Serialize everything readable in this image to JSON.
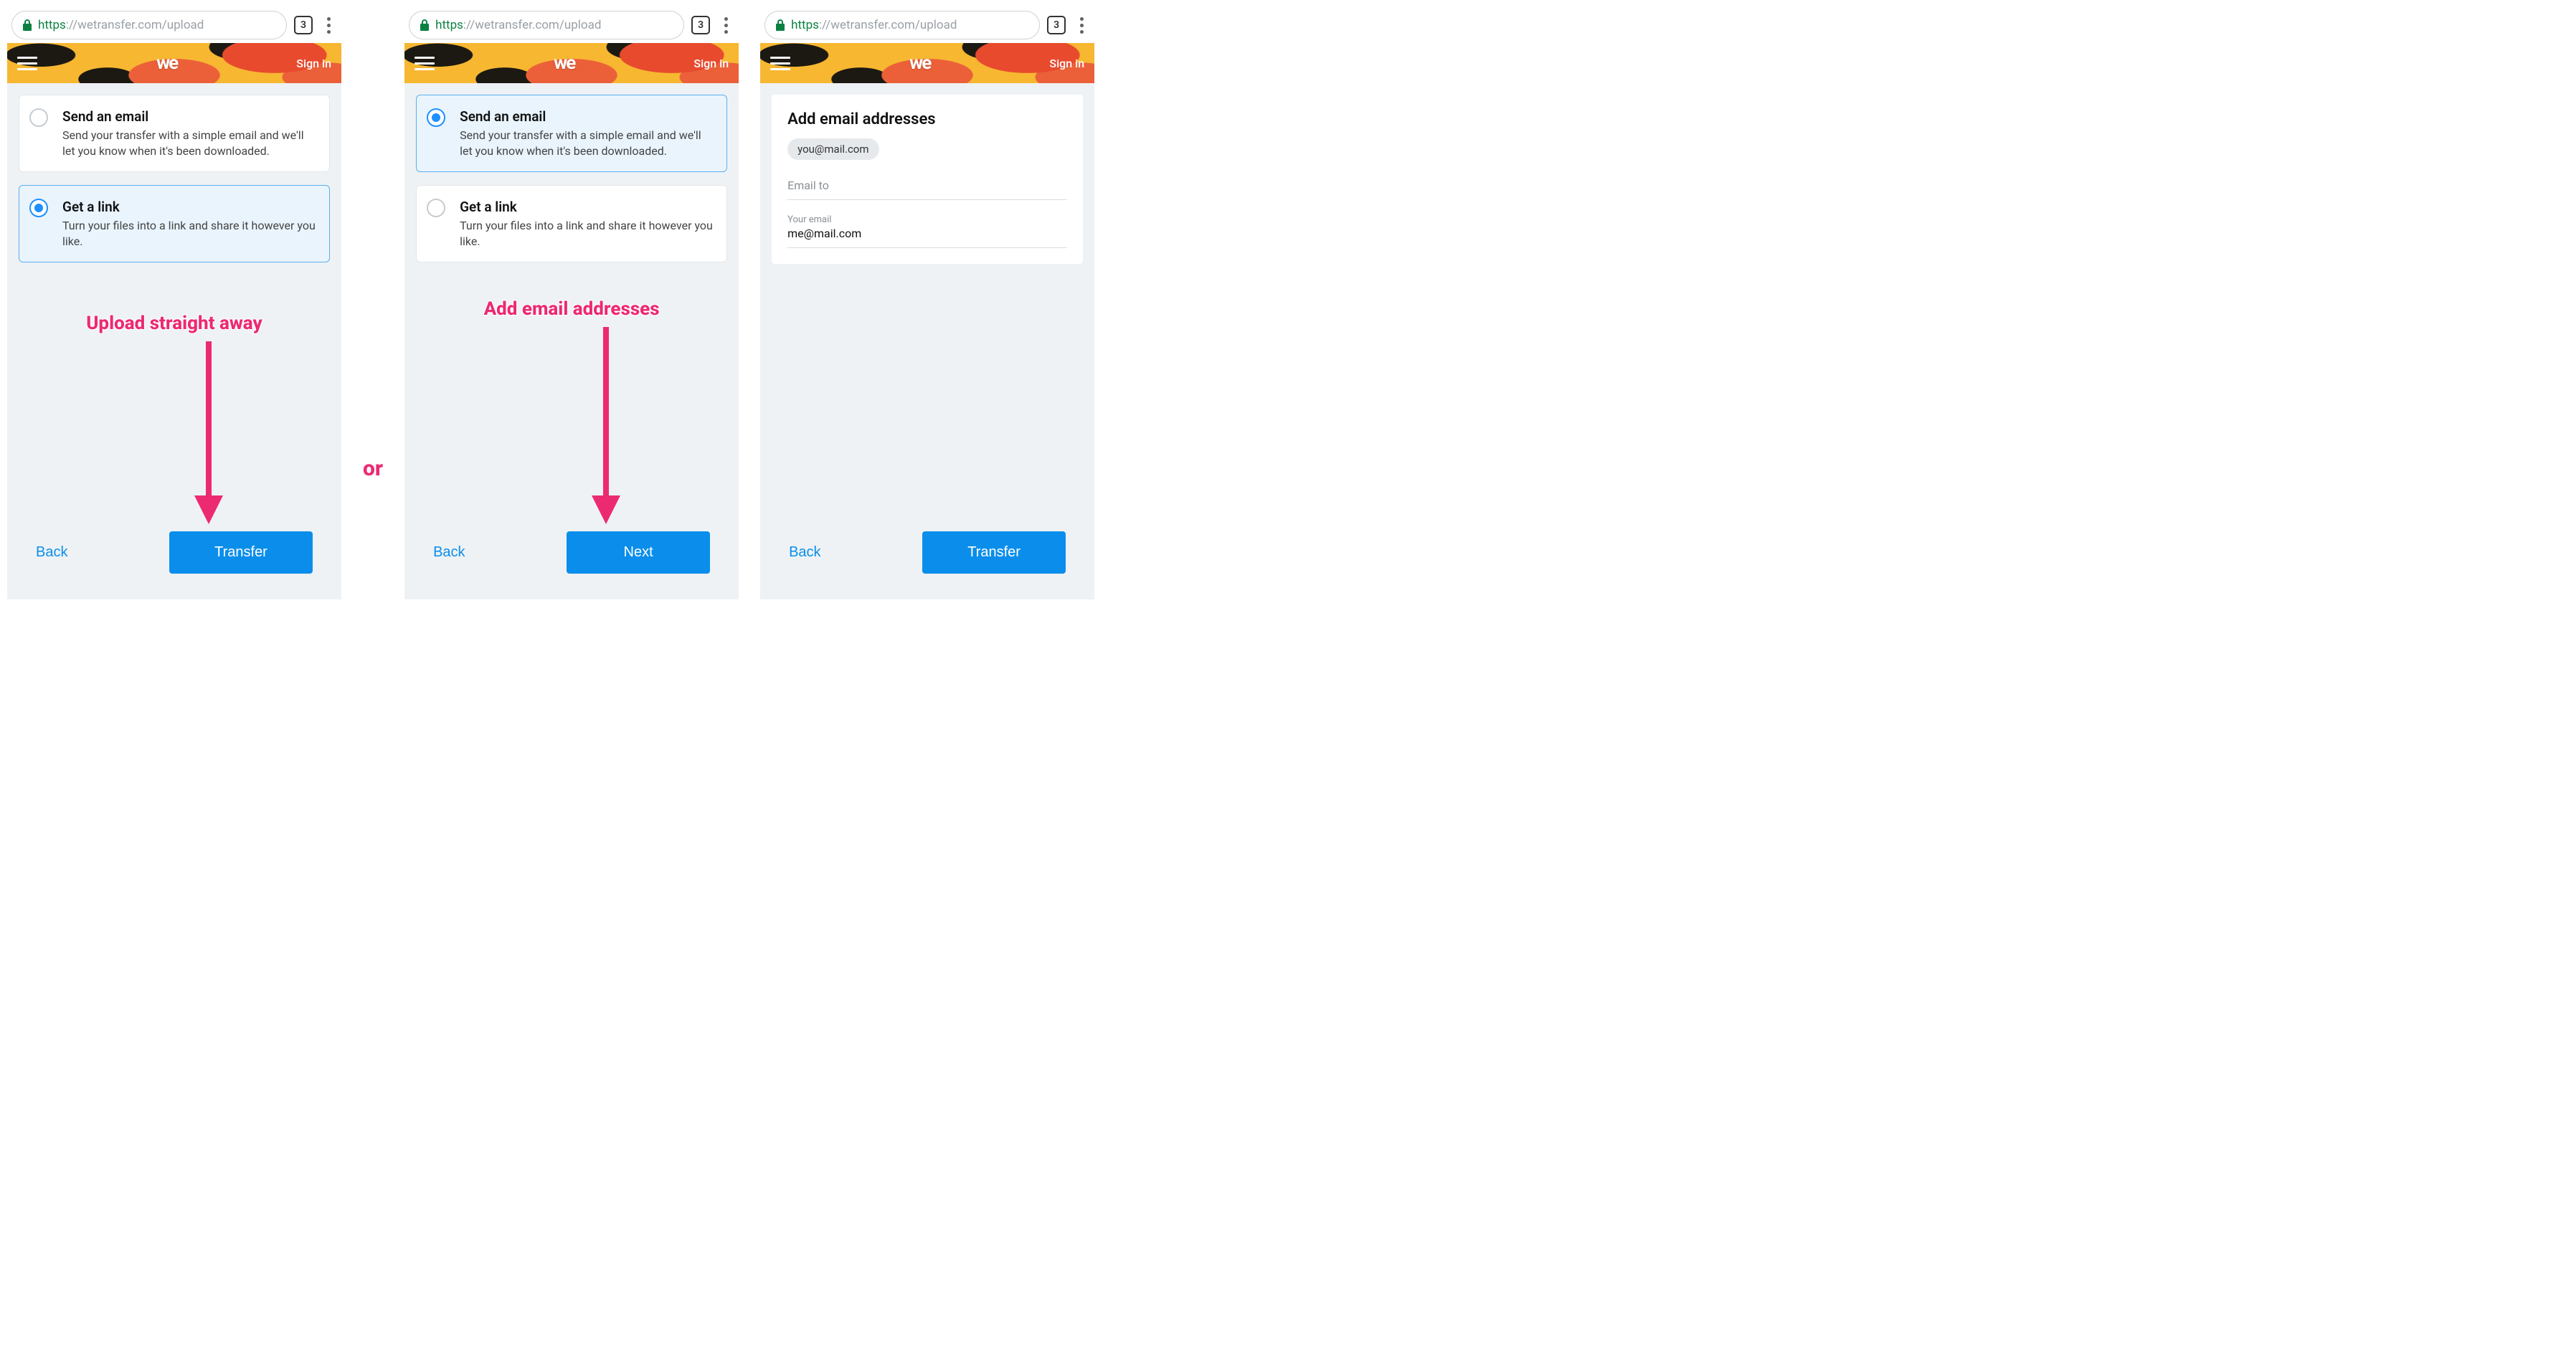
{
  "browser": {
    "url_scheme": "https",
    "url_host": "://wetransfer.com",
    "url_path": "/upload",
    "tab_count": "3"
  },
  "banner": {
    "logo_text": "we",
    "signin": "Sign in"
  },
  "options": {
    "email_title": "Send an email",
    "email_desc": "Send your transfer with a simple email and we'll let you know when it's been downloaded.",
    "link_title": "Get a link",
    "link_desc": "Turn your files into a link and share it however you like."
  },
  "email_form": {
    "heading": "Add email addresses",
    "chip": "you@mail.com",
    "to_label": "Email to",
    "your_label": "Your email",
    "your_value": "me@mail.com"
  },
  "buttons": {
    "back": "Back",
    "transfer": "Transfer",
    "next": "Next"
  },
  "annotations": {
    "left": "Upload straight away",
    "middle": "Add email addresses",
    "or": "or"
  }
}
